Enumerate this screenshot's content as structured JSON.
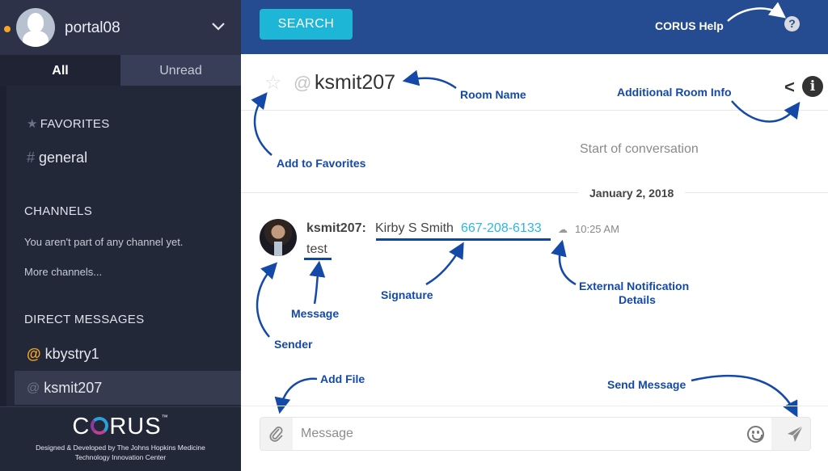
{
  "sidebar": {
    "user": {
      "name": "portal08",
      "status_color": "#f5a623"
    },
    "tabs": [
      {
        "label": "All",
        "active": true
      },
      {
        "label": "Unread",
        "active": false
      }
    ],
    "favorites": {
      "title": "FAVORITES",
      "items": [
        {
          "symbol": "#",
          "label": "general"
        }
      ]
    },
    "channels": {
      "title": "CHANNELS",
      "empty_text": "You aren't part of any channel yet.",
      "more_link": "More channels..."
    },
    "direct_messages": {
      "title": "DIRECT MESSAGES",
      "items": [
        {
          "symbol": "@",
          "label": "kbystry1",
          "symbol_color": "#f5a623",
          "active": false
        },
        {
          "symbol": "@",
          "label": "ksmit207",
          "active": true
        }
      ]
    },
    "footer": {
      "logo_text": "CORUS",
      "trademark": "™",
      "credit_line1": "Designed & Developed by The Johns Hopkins Medicine",
      "credit_line2": "Technology Innovation Center"
    }
  },
  "topbar": {
    "search_label": "SEARCH",
    "help_label": "CORUS Help",
    "help_icon": "?"
  },
  "room": {
    "at_symbol": "@",
    "name": "ksmit207",
    "back_symbol": "<",
    "info_symbol": "i",
    "star_symbol": "☆"
  },
  "conversation": {
    "start_text": "Start of conversation",
    "date": "January 2, 2018",
    "messages": [
      {
        "sender": "ksmit207:",
        "signature_name": "Kirby S Smith",
        "signature_phone": "667-208-6133",
        "time": "10:25 AM",
        "text": "test"
      }
    ]
  },
  "annotations": {
    "room_name": "Room Name",
    "additional_info": "Additional Room Info",
    "add_favorites": "Add to Favorites",
    "message": "Message",
    "signature": "Signature",
    "external_1": "External Notification",
    "external_2": "Details",
    "sender": "Sender",
    "add_file": "Add File",
    "send_message": "Send Message"
  },
  "composer": {
    "placeholder": "Message"
  },
  "colors": {
    "topbar": "#254b90",
    "search": "#1eb6d6",
    "sidebar": "#232839",
    "annotation": "#1449a8",
    "phone_link": "#2db8db"
  }
}
